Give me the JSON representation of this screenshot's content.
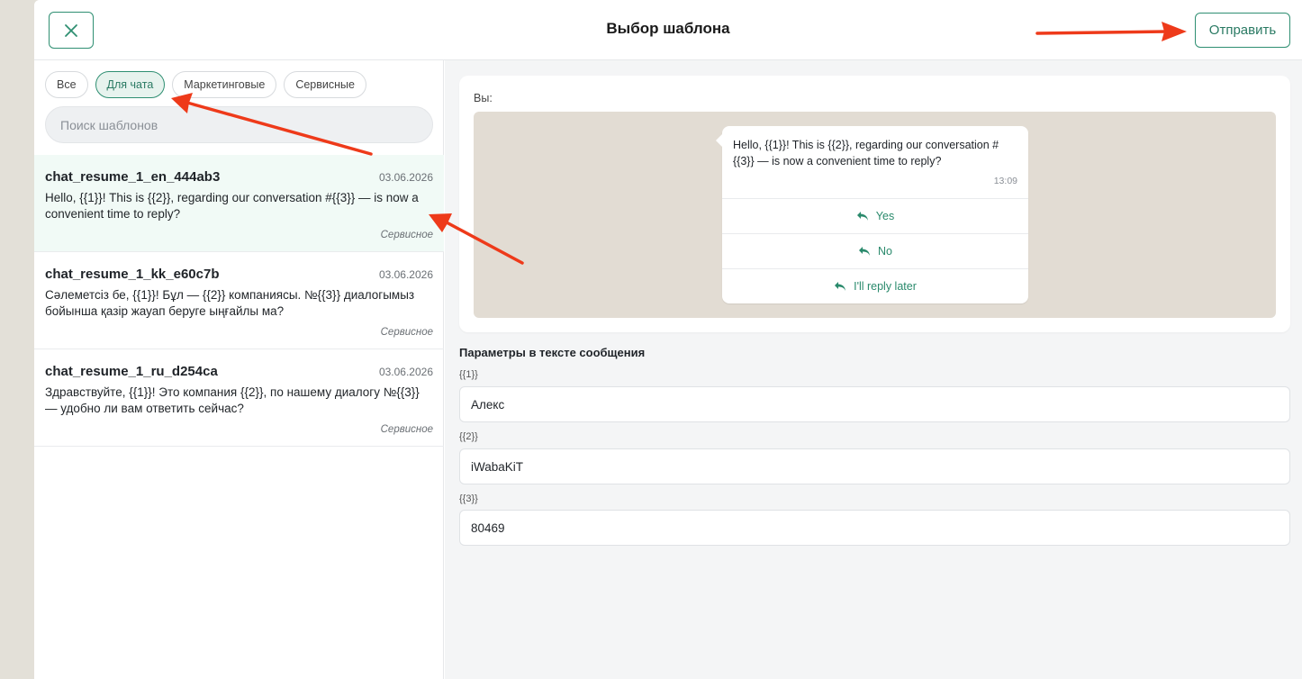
{
  "header": {
    "title": "Выбор шаблона",
    "send_label": "Отправить"
  },
  "filters": {
    "chips": [
      "Все",
      "Для чата",
      "Маркетинговые",
      "Сервисные"
    ],
    "active": "Для чата"
  },
  "search": {
    "placeholder": "Поиск шаблонов",
    "value": ""
  },
  "templates": [
    {
      "name": "chat_resume_1_en_444ab3",
      "date": "03.06.2026",
      "text": "Hello, {{1}}! This is {{2}}, regarding our conversation #{{3}} — is now a convenient time to reply?",
      "category": "Сервисное"
    },
    {
      "name": "chat_resume_1_kk_e60c7b",
      "date": "03.06.2026",
      "text": "Сәлеметсіз бе, {{1}}! Бұл — {{2}} компаниясы. №{{3}} диалогымыз бойынша қазір жауап беруге ыңғайлы ма?",
      "category": "Сервисное"
    },
    {
      "name": "chat_resume_1_ru_d254ca",
      "date": "03.06.2026",
      "text": "Здравствуйте, {{1}}! Это компания {{2}}, по нашему диалогу №{{3}} — удобно ли вам ответить сейчас?",
      "category": "Сервисное"
    }
  ],
  "preview": {
    "sender_label": "Вы:",
    "message": "Hello, {{1}}! This is {{2}}, regarding our conversation #{{3}} — is now a convenient time to reply?",
    "time": "13:09",
    "quick_replies": [
      "Yes",
      "No",
      "I'll reply later"
    ]
  },
  "params": {
    "title": "Параметры в тексте сообщения",
    "fields": [
      {
        "label": "{{1}}",
        "value": "Алекс"
      },
      {
        "label": "{{2}}",
        "value": "iWabaKiT"
      },
      {
        "label": "{{3}}",
        "value": "80469"
      }
    ]
  },
  "colors": {
    "accent": "#2f8f72",
    "selected_row": "#f1faf6",
    "chat_background": "#e2dcd3",
    "annotation_arrow": "#ee3a1a"
  }
}
